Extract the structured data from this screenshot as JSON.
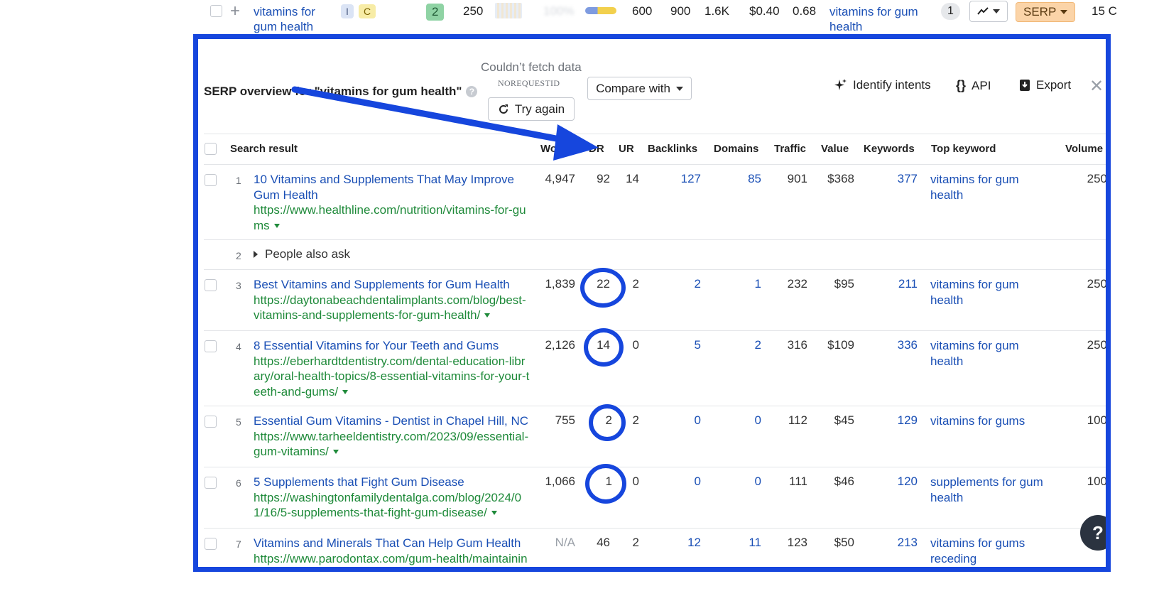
{
  "top_row": {
    "keyword": "vitamins for gum health",
    "intent_badges": [
      "I",
      "C"
    ],
    "kd": "2",
    "volume": "250",
    "blurred_value": "100%",
    "col_a": "600",
    "col_b": "900",
    "col_c": "1.6K",
    "cpc": "$0.40",
    "cps": "0.68",
    "parent_topic": "vitamins for gum health",
    "sf_count": "1",
    "serp_label": "SERP",
    "last_col": "15 C"
  },
  "panel": {
    "title": "SERP overview for \"vitamins for gum health\"",
    "help_icon": "?",
    "fetch_error": "Couldn’t fetch data",
    "error_code": "NOREQUESTID",
    "try_again": "Try again",
    "compare_with": "Compare with",
    "identify_intents": "Identify intents",
    "api": "API",
    "export": "Export",
    "close": "✕",
    "fab": "?"
  },
  "columns": [
    "Search result",
    "Words",
    "DR",
    "UR",
    "Backlinks",
    "Domains",
    "Traffic",
    "Value",
    "Keywords",
    "Top keyword",
    "Volume"
  ],
  "column_visible": {
    "Words": "Wo",
    "Volume": "Volume"
  },
  "rows": [
    {
      "rank": "1",
      "title": "10 Vitamins and Supplements That May Improve Gum Health",
      "url": "https://www.healthline.com/nutrition/vitamins-for-gums",
      "words": "4,947",
      "dr": "92",
      "ur": "14",
      "backlinks": "127",
      "domains": "85",
      "traffic": "901",
      "value": "$368",
      "keywords": "377",
      "top_keyword": "vitamins for gum health",
      "volume": "250"
    },
    {
      "rank": "2",
      "people_also_ask": "People also ask"
    },
    {
      "rank": "3",
      "title": "Best Vitamins and Supplements for Gum Health",
      "url": "https://daytonabeachdentalimplants.com/blog/best-vitamins-and-supplements-for-gum-health/",
      "words": "1,839",
      "dr": "22",
      "ur": "2",
      "backlinks": "2",
      "domains": "1",
      "traffic": "232",
      "value": "$95",
      "keywords": "211",
      "top_keyword": "vitamins for gum health",
      "volume": "250"
    },
    {
      "rank": "4",
      "title": "8 Essential Vitamins for Your Teeth and Gums",
      "url": "https://eberhardtdentistry.com/dental-education-library/oral-health-topics/8-essential-vitamins-for-your-teeth-and-gums/",
      "words": "2,126",
      "dr": "14",
      "ur": "0",
      "backlinks": "5",
      "domains": "2",
      "traffic": "316",
      "value": "$109",
      "keywords": "336",
      "top_keyword": "vitamins for gum health",
      "volume": "250"
    },
    {
      "rank": "5",
      "title": "Essential Gum Vitamins - Dentist in Chapel Hill, NC",
      "url": "https://www.tarheeldentistry.com/2023/09/essential-gum-vitamins/",
      "words": "755",
      "dr": "2",
      "ur": "2",
      "backlinks": "0",
      "domains": "0",
      "traffic": "112",
      "value": "$45",
      "keywords": "129",
      "top_keyword": "vitamins for gums",
      "volume": "100"
    },
    {
      "rank": "6",
      "title": "5 Supplements that Fight Gum Disease",
      "url": "https://washingtonfamilydentalga.com/blog/2024/01/16/5-supplements-that-fight-gum-disease/",
      "words": "1,066",
      "dr": "1",
      "ur": "0",
      "backlinks": "0",
      "domains": "0",
      "traffic": "111",
      "value": "$46",
      "keywords": "120",
      "top_keyword": "supplements for gum health",
      "volume": "100"
    },
    {
      "rank": "7",
      "title": "Vitamins and Minerals That Can Help Gum Health",
      "url": "https://www.parodontax.com/gum-health/maintaining",
      "words": "N/A",
      "dr": "46",
      "ur": "2",
      "backlinks": "12",
      "domains": "11",
      "traffic": "123",
      "value": "$50",
      "keywords": "213",
      "top_keyword": "vitamins for gums receding",
      "volume": ""
    }
  ],
  "colors": {
    "annotation_blue": "#1646dd",
    "link_blue": "#1a4fb5",
    "url_green": "#1f8a3a",
    "serp_orange": "#fbd4a8",
    "kd_green": "#8fd3a4"
  }
}
